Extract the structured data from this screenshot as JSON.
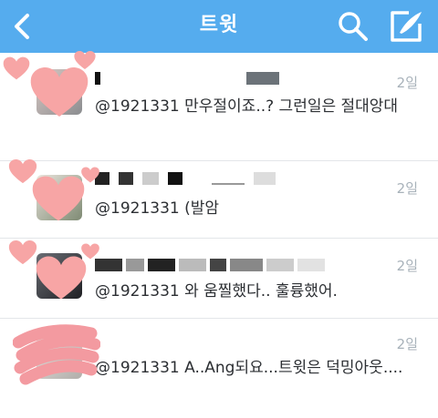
{
  "header": {
    "title": "트윗",
    "back_icon": "chevron-left-icon",
    "search_icon": "search-icon",
    "compose_icon": "compose-icon",
    "bar_color": "#55acee"
  },
  "tweets": [
    {
      "time": "2일",
      "text": "@1921331 만우절이죠..? 그런일은 절대앙대"
    },
    {
      "time": "2일",
      "text": "@1921331 (발암"
    },
    {
      "time": "2일",
      "text": "@1921331 와 움찔했다.. 훌륭했어."
    },
    {
      "time": "2일",
      "text": "@1921331 A..Ang되요...트윗은 덕밍아웃...."
    }
  ]
}
